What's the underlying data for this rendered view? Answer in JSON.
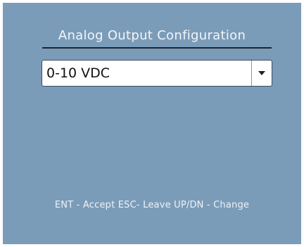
{
  "screen": {
    "title": "Analog Output Configuration",
    "selected_value": "0-10 VDC",
    "help_text": "ENT - Accept ESC- Leave UP/DN - Change"
  },
  "icons": {
    "dropdown": "chevron-down-icon"
  },
  "colors": {
    "background": "#7b9cb9",
    "text": "#f3f5f8",
    "rule": "#1c2530"
  }
}
